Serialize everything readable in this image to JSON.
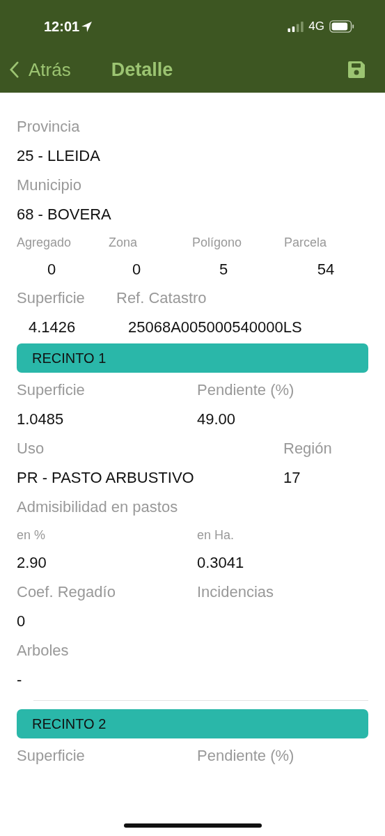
{
  "status_bar": {
    "time": "12:01",
    "network": "4G"
  },
  "nav": {
    "back": "Atrás",
    "title": "Detalle"
  },
  "parcel": {
    "provincia": {
      "label": "Provincia",
      "value": "25 - LLEIDA"
    },
    "municipio": {
      "label": "Municipio",
      "value": "68 - BOVERA"
    },
    "codes": [
      {
        "label": "Agregado",
        "value": "0"
      },
      {
        "label": "Zona",
        "value": "0"
      },
      {
        "label": "Polígono",
        "value": "5"
      },
      {
        "label": "Parcela",
        "value": "54"
      }
    ],
    "superficie": {
      "label": "Superficie",
      "value": "4.1426"
    },
    "ref": {
      "label": "Ref. Catastro",
      "value": "25068A005000540000LS"
    }
  },
  "recintos": [
    {
      "title": "RECINTO 1",
      "rows": [
        {
          "kind": "pair",
          "cells": [
            {
              "label": "Superficie",
              "value": "1.0485"
            },
            {
              "label": "Pendiente (%)",
              "value": "49.00"
            }
          ]
        },
        {
          "kind": "wide",
          "cells": [
            {
              "label": "Uso",
              "value": "PR - PASTO ARBUSTIVO"
            },
            {
              "label": "Región",
              "value": "17"
            }
          ]
        },
        {
          "kind": "heading",
          "cells": [
            {
              "label": "Admisibilidad en pastos"
            }
          ]
        },
        {
          "kind": "small",
          "cells": [
            {
              "label": "en %",
              "value": "2.90"
            },
            {
              "label": "en Ha.",
              "value": "0.3041"
            }
          ]
        },
        {
          "kind": "pair",
          "cells": [
            {
              "label": "Coef. Regadío",
              "value": "0"
            },
            {
              "label": "Incidencias"
            }
          ]
        },
        {
          "kind": "pair",
          "cells": [
            {
              "label": "Arboles",
              "value": "-"
            }
          ]
        }
      ]
    },
    {
      "title": "RECINTO 2",
      "rows": [
        {
          "kind": "pair",
          "cells": [
            {
              "label": "Superficie"
            },
            {
              "label": "Pendiente (%)"
            }
          ]
        }
      ]
    }
  ]
}
